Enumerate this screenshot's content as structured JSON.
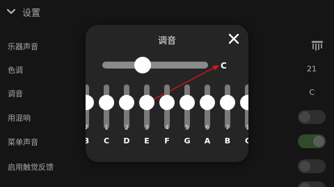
{
  "header": {
    "title": "设置"
  },
  "settings": [
    {
      "label": "乐器声音"
    },
    {
      "label": "色调",
      "value": "21"
    },
    {
      "label": "调音",
      "value": "C"
    },
    {
      "label": "用混响"
    },
    {
      "label": "菜单声音"
    },
    {
      "label": "启用触觉反馈"
    }
  ],
  "toggles": {
    "reverb": false,
    "menu_sound": true,
    "haptic": false
  },
  "dialog": {
    "title": "调音",
    "tuning_key": "C",
    "slider_fraction": 0.38,
    "keys": [
      {
        "num": "7",
        "note": "B"
      },
      {
        "num": "1",
        "note": "C"
      },
      {
        "num": "2",
        "note": "D"
      },
      {
        "num": "3",
        "note": "E"
      },
      {
        "num": "4",
        "note": "F"
      },
      {
        "num": "5",
        "note": "G"
      },
      {
        "num": "6",
        "note": "A"
      },
      {
        "num": "7",
        "note": "B"
      },
      {
        "num": "1",
        "note": "C"
      }
    ]
  },
  "colors": {
    "background": "#151515",
    "dialog": "#252526",
    "arrow": "#e0141a",
    "toggle_on": "#2f4b2a"
  }
}
